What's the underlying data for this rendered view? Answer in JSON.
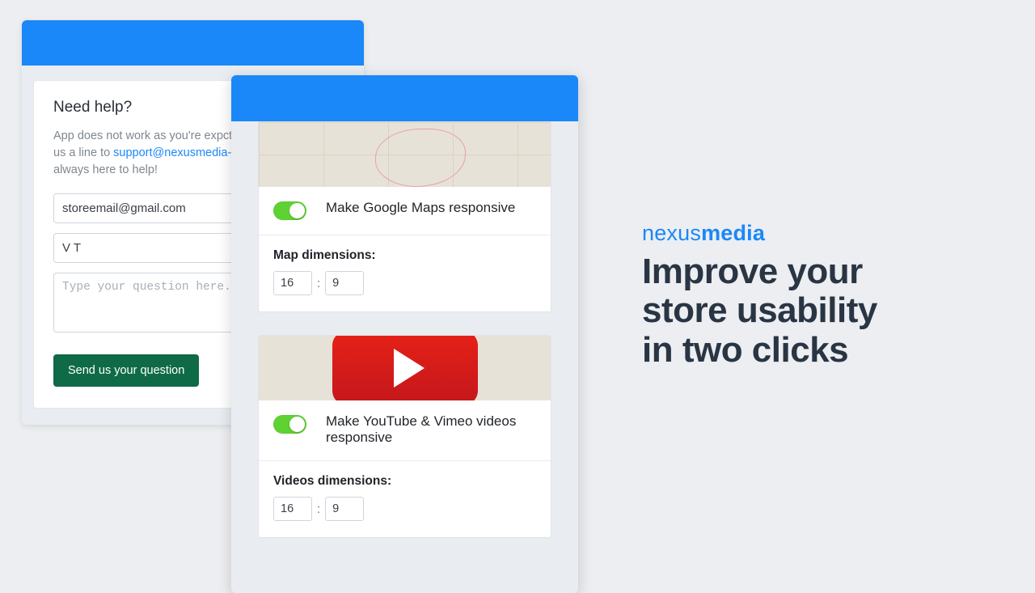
{
  "help": {
    "title": "Need help?",
    "desc_pre": "App does not work as you're expct. Feel free to drop us a line to ",
    "email": "support@nexusmedia-ua.com",
    "desc_post": ", our always here to help!",
    "email_value": "storeemail@gmail.com",
    "name_value": "V T",
    "question_placeholder": "Type your question here...",
    "send_label": "Send us your question"
  },
  "settings": {
    "maps": {
      "toggle_label": "Make Google Maps responsive",
      "dim_label": "Map dimensions:",
      "w": "16",
      "h": "9"
    },
    "videos": {
      "toggle_label": "Make YouTube & Vimeo videos responsive",
      "dim_label": "Videos dimensions:",
      "w": "16",
      "h": "9"
    }
  },
  "brand": {
    "part1": "nexus",
    "part2": "media"
  },
  "tagline": {
    "l1": "Improve your",
    "l2": "store usability",
    "l3": "in two clicks"
  },
  "colors": {
    "accent": "#1a88f8",
    "toggle_on": "#5fd233",
    "send_btn": "#0f6a47"
  }
}
